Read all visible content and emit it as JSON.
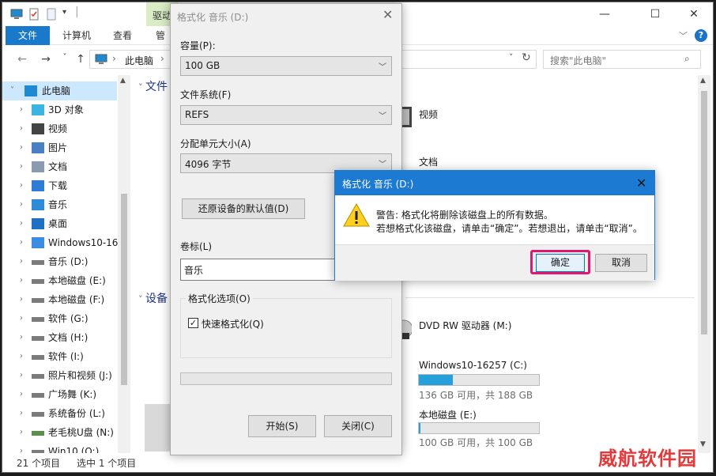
{
  "explorer": {
    "ribbon_context_label": "驱动",
    "ribbon_tabs": [
      "文件",
      "计算机",
      "查看",
      "管"
    ],
    "address_text": "此电脑",
    "search_placeholder": "搜索\"此电脑\"",
    "nav_items": [
      {
        "label": "此电脑",
        "icon": "pc-icon",
        "expanded": true
      },
      {
        "label": "3D 对象",
        "icon": "3d-objects-icon"
      },
      {
        "label": "视频",
        "icon": "video-icon"
      },
      {
        "label": "图片",
        "icon": "pictures-icon"
      },
      {
        "label": "文档",
        "icon": "documents-icon"
      },
      {
        "label": "下载",
        "icon": "downloads-icon"
      },
      {
        "label": "音乐",
        "icon": "music-icon"
      },
      {
        "label": "桌面",
        "icon": "desktop-icon"
      },
      {
        "label": "Windows10-16",
        "icon": "windows-drive-icon"
      },
      {
        "label": "音乐 (D:)",
        "icon": "drive-icon"
      },
      {
        "label": "本地磁盘 (E:)",
        "icon": "drive-icon"
      },
      {
        "label": "本地磁盘 (F:)",
        "icon": "drive-icon"
      },
      {
        "label": "软件 (G:)",
        "icon": "drive-icon"
      },
      {
        "label": "文档 (H:)",
        "icon": "drive-icon"
      },
      {
        "label": "软件  (I:)",
        "icon": "drive-icon"
      },
      {
        "label": "照片和视频 (J:)",
        "icon": "drive-icon"
      },
      {
        "label": "广场舞 (K:)",
        "icon": "drive-icon"
      },
      {
        "label": "系统备份 (L:)",
        "icon": "drive-icon"
      },
      {
        "label": "老毛桃U盘 (N:)",
        "icon": "usb-drive-icon"
      },
      {
        "label": "Win10 (O:)",
        "icon": "drive-icon"
      }
    ],
    "status_count": "21 个项目",
    "status_selected": "选中 1 个项目",
    "group_folders": "文件",
    "group_devices": "设备",
    "folder_videos": "视频",
    "folder_documents": "文档",
    "dvd_drive": "DVD RW 驱动器 (M:)",
    "drives": [
      {
        "name": "Windows10-16257 (C:)",
        "free": "136 GB 可用，共 188 GB",
        "used_fraction": 0.28
      },
      {
        "name": "本地磁盘 (E:)",
        "free": "100 GB 可用，共 100 GB",
        "used_fraction": 0.01
      }
    ]
  },
  "format_dialog": {
    "title": "格式化 音乐 (D:)",
    "capacity_label": "容量(P):",
    "capacity_value": "100 GB",
    "filesystem_label": "文件系统(F)",
    "filesystem_value": "REFS",
    "allocation_label": "分配单元大小(A)",
    "allocation_value": "4096 字节",
    "restore_defaults": "还原设备的默认值(D)",
    "volume_label_label": "卷标(L)",
    "volume_label_value": "音乐",
    "options_legend": "格式化选项(O)",
    "quick_format": "快速格式化(Q)",
    "quick_format_checked": true,
    "progress": 0,
    "start_button": "开始(S)",
    "close_button": "关闭(C)"
  },
  "warning_dialog": {
    "title": "格式化 音乐 (D:)",
    "line1": "警告: 格式化将删除该磁盘上的所有数据。",
    "line2": "若想格式化该磁盘，请单击“确定”。若想退出，请单击“取消”。",
    "ok_button": "确定",
    "cancel_button": "取消",
    "highlight_color": "#e2176e"
  },
  "watermark": "威航软件园"
}
